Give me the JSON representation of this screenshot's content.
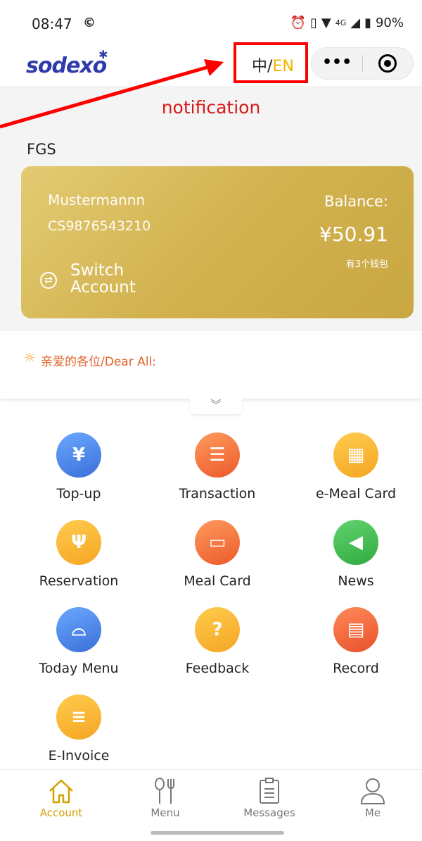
{
  "status_bar": {
    "time": "08:47",
    "battery": "90%",
    "network": "4G"
  },
  "header": {
    "logo_text": "sodexo",
    "lang_zh": "中",
    "lang_sep": "/",
    "lang_en": "EN",
    "more_icon": "more-dots-icon",
    "close_icon": "target-circle-icon"
  },
  "page": {
    "notification_title": "notification",
    "org_name": "FGS"
  },
  "card": {
    "holder_name": "Mustermannn",
    "card_id": "CS9876543210",
    "balance_label": "Balance:",
    "balance_value": "¥50.91",
    "wallet_count": "有3个钱包",
    "switch_label": "Switch Account"
  },
  "notice": {
    "text": "亲爱的各位/Dear All:"
  },
  "grid": [
    {
      "label": "Top-up",
      "icon": "yen-coin-icon"
    },
    {
      "label": "Transaction",
      "icon": "clipboard-icon"
    },
    {
      "label": "e-Meal Card",
      "icon": "qr-code-icon"
    },
    {
      "label": "Reservation",
      "icon": "cutlery-icon"
    },
    {
      "label": "Meal Card",
      "icon": "card-icon"
    },
    {
      "label": "News",
      "icon": "megaphone-icon"
    },
    {
      "label": "Today Menu",
      "icon": "cloche-icon"
    },
    {
      "label": "Feedback",
      "icon": "question-edit-icon"
    },
    {
      "label": "Record",
      "icon": "document-icon"
    },
    {
      "label": "E-Invoice",
      "icon": "invoice-icon"
    }
  ],
  "tabbar": [
    {
      "label": "Account",
      "icon": "home-icon",
      "active": true
    },
    {
      "label": "Menu",
      "icon": "spoon-fork-icon"
    },
    {
      "label": "Messages",
      "icon": "list-document-icon"
    },
    {
      "label": "Me",
      "icon": "person-icon"
    }
  ],
  "colors": {
    "brand_blue": "#2f3ba8",
    "accent_gold": "#f0b400",
    "card_gold": "#d2b24f",
    "notification_red": "#d81a1a",
    "annotation_red": "#ff0000"
  }
}
